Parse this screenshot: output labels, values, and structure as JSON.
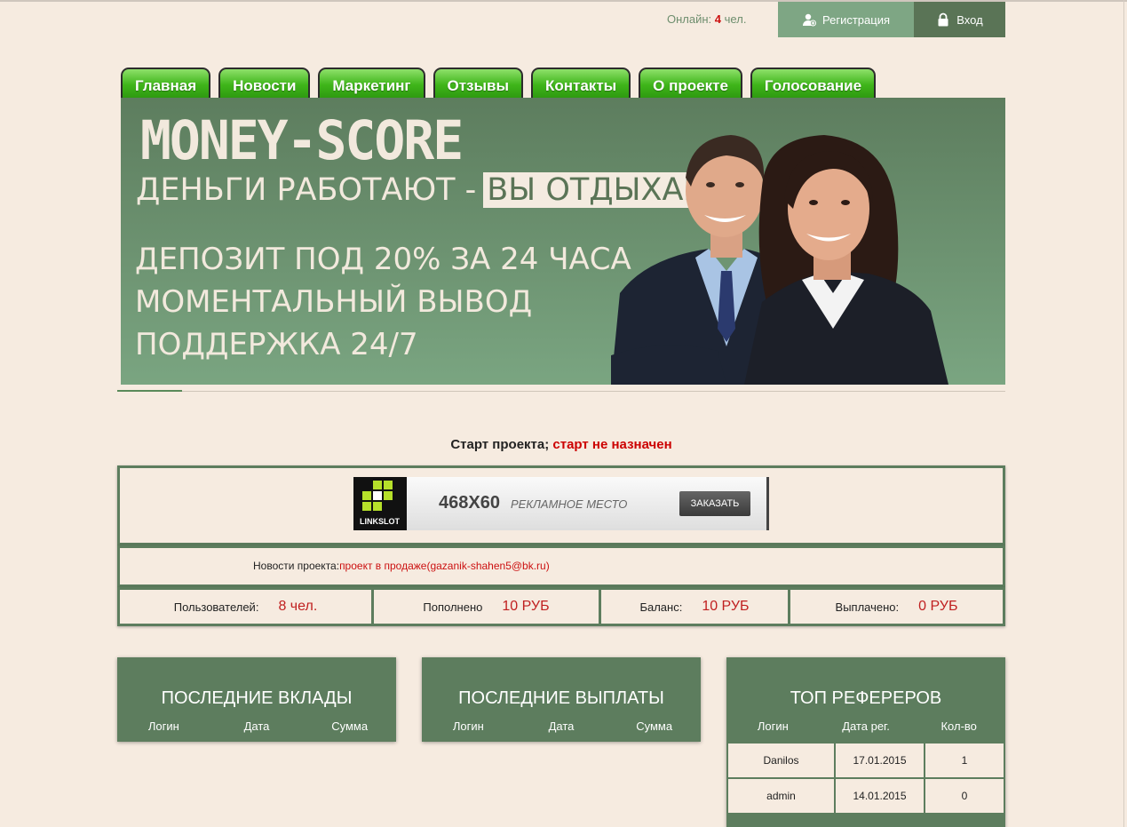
{
  "topbar": {
    "online_label": "Онлайн:",
    "online_count": "4",
    "online_unit": "чел.",
    "register": "Регистрация",
    "login": "Вход"
  },
  "nav": [
    "Главная",
    "Новости",
    "Маркетинг",
    "Отзывы",
    "Контакты",
    "О проекте",
    "Голосование"
  ],
  "banner": {
    "brand": "MONEY-SCORE",
    "slogan_main": "ДЕНЬГИ РАБОТАЮТ -",
    "slogan_highlight": "ВЫ ОТДЫХАЕТЕ",
    "feature_1": "ДЕПОЗИТ ПОД 20% ЗА 24 ЧАСА",
    "feature_2": "МОМЕНТАЛЬНЫЙ ВЫВОД",
    "feature_3": "ПОДДЕРЖКА 24/7"
  },
  "start": {
    "label": "Старт проекта;",
    "value": "старт не назначен"
  },
  "ad": {
    "logo": "LINKSLOT",
    "size": "468X60",
    "text": "РЕКЛАМНОЕ МЕСТО",
    "button": "ЗАКАЗАТЬ"
  },
  "news": {
    "label": "Новости проекта:",
    "text": "проект в продаже(gazanik-shahen5@bk.ru)"
  },
  "stats": [
    {
      "label": "Пользователей:",
      "value": "8 чел."
    },
    {
      "label": "Пополнено",
      "value": "10 РУБ"
    },
    {
      "label": "Баланс:",
      "value": "10 РУБ"
    },
    {
      "label": "Выплачено:",
      "value": "0 РУБ"
    }
  ],
  "panels": {
    "deposits": {
      "title": "ПОСЛЕДНИЕ ВКЛАДЫ",
      "cols": [
        "Логин",
        "Дата",
        "Сумма"
      ]
    },
    "payouts": {
      "title": "ПОСЛЕДНИЕ ВЫПЛАТЫ",
      "cols": [
        "Логин",
        "Дата",
        "Сумма"
      ]
    },
    "referrers": {
      "title": "ТОП РЕФЕРЕРОВ",
      "cols": [
        "Логин",
        "Дата рег.",
        "Кол-во"
      ],
      "rows": [
        [
          "Danilos",
          "17.01.2015",
          "1"
        ],
        [
          "admin",
          "14.01.2015",
          "0"
        ]
      ]
    }
  },
  "colors": {
    "accent_green": "#5d7d5e",
    "light_green": "#7ea684",
    "tab_green": "#3fb51a",
    "value_red": "#c02020",
    "background": "#f6ebe0"
  }
}
